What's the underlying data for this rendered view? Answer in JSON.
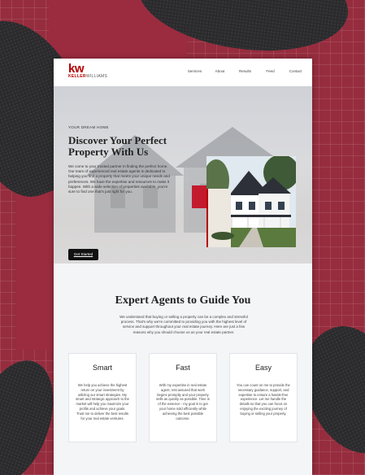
{
  "brand": {
    "logo_mark": "kw",
    "logo_name_first": "KELLER",
    "logo_name_second": "WILLIAMS"
  },
  "nav": {
    "items": [
      {
        "label": "Services"
      },
      {
        "label": "About"
      },
      {
        "label": "Results"
      },
      {
        "label": "Feed"
      },
      {
        "label": "Contact"
      }
    ]
  },
  "hero": {
    "eyebrow": "YOUR DREAM HOME",
    "title": "Discover Your Perfect Property With Us",
    "description": "We come to your trusted partner in finding the perfect home. Our team of experienced real estate agents is dedicated to helping you find a property that meets your unique needs and preferences. We have the expertise and resources to make it happen. With a wide selection of properties available, you're sure to find one that's just right for you.",
    "cta_label": "Get Started"
  },
  "agents_section": {
    "title": "Expert Agents to Guide You",
    "description": "We understand that buying or selling a property can be a complex and stressful process. That's why we're committed to providing you with the highest level of service and support throughout your real estate journey. Here are just a few reasons why you should choose us as your real estate partner."
  },
  "cards": [
    {
      "title": "Smart",
      "text": "We help you achieve the highest return on your investment by utilizing our smart strategies. My smart and strategic approach to the market will help you maximize your profits and achieve your goals. Trust me to deliver the best results for your real estate ventures."
    },
    {
      "title": "Fast",
      "text": "With my expertise in real estate agent, rest assured that work begins promptly and your property sells as quickly as possible. Time is of the essence - my goal is to get your home sold efficiently while achieving the best possible outcome."
    },
    {
      "title": "Easy",
      "text": "You can count on me to provide the necessary guidance, support, and expertise to ensure a hassle-free experience. Let me handle the details so that you can focus on enjoying the exciting journey of buying or selling your property."
    }
  ],
  "colors": {
    "brand_red": "#b40101",
    "background_maroon": "#962d3e",
    "accent_red": "#c41a2e",
    "cta_black": "#111111"
  }
}
